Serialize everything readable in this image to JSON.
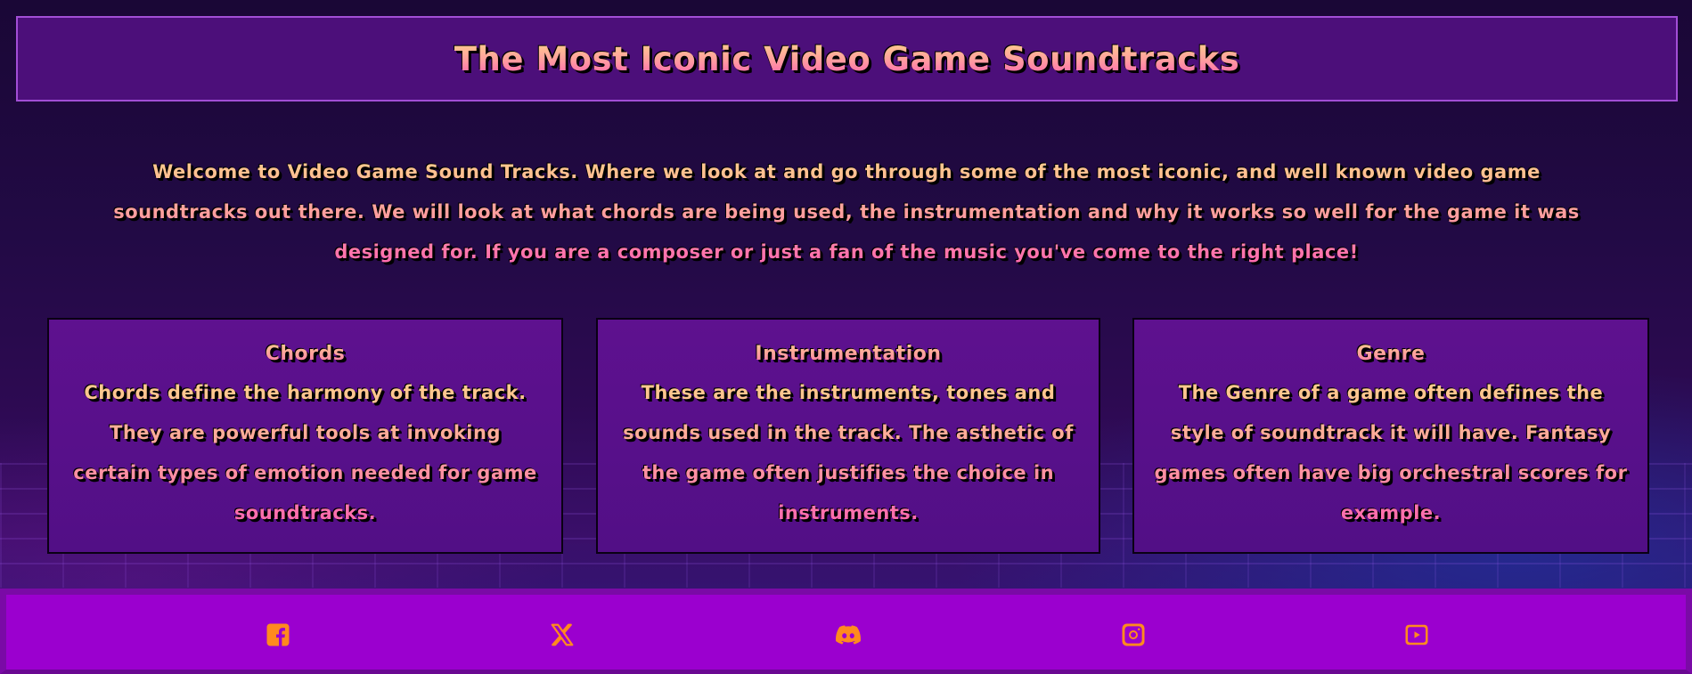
{
  "header": {
    "title": "The Most Iconic Video Game Soundtracks"
  },
  "intro": {
    "text": "Welcome to Video Game Sound Tracks. Where we look at and go through some of the most iconic, and well known video game soundtracks out there. We will look at what chords are being used, the instrumentation and why it works so well for the game it was designed for. If you are a composer or just a fan of the music you've come to the right place!"
  },
  "cards": [
    {
      "title": "Chords",
      "body": "Chords define the harmony of the track. They are powerful tools at invoking certain types of emotion needed for game soundtracks."
    },
    {
      "title": "Instrumentation",
      "body": "These are the instruments, tones and sounds used in the track. The asthetic of the game often justifies the choice in instruments."
    },
    {
      "title": "Genre",
      "body": "The Genre of a game often defines the style of soundtrack it will have. Fantasy games often have big orchestral scores for example."
    }
  ],
  "footer": {
    "icons": [
      "facebook-icon",
      "x-twitter-icon",
      "discord-icon",
      "instagram-icon",
      "youtube-icon"
    ],
    "icon_color": "#ff8a1e"
  },
  "colors": {
    "header_bg": "#4c0f7a",
    "card_bg": "#5e118f",
    "footer_bg": "#9b00cf",
    "text_gradient_top": "#ffd38a",
    "text_gradient_bottom": "#ff5fb3"
  }
}
